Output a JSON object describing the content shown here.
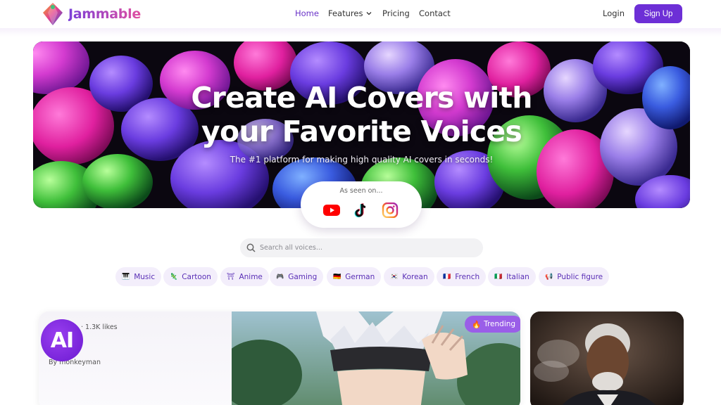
{
  "brand": {
    "name": "Jammable"
  },
  "nav": {
    "home": "Home",
    "features": "Features",
    "pricing": "Pricing",
    "contact": "Contact",
    "login": "Login",
    "signup": "Sign Up"
  },
  "hero": {
    "title_line1": "Create AI Covers with",
    "title_line2": "your Favorite Voices",
    "subtitle": "The #1 platform for making high quality AI covers in seconds!",
    "seen_on": "As seen on...",
    "platforms": [
      "youtube-icon",
      "tiktok-icon",
      "instagram-icon"
    ]
  },
  "search": {
    "placeholder": "Search all voices..."
  },
  "categories": [
    {
      "emoji": "🎹",
      "label": "Music"
    },
    {
      "emoji": "🦎",
      "label": "Cartoon"
    },
    {
      "emoji": "⛩",
      "label": "Anime"
    },
    {
      "emoji": "🎮",
      "label": "Gaming"
    },
    {
      "emoji": "🇩🇪",
      "label": "German"
    },
    {
      "emoji": "🇰🇷",
      "label": "Korean"
    },
    {
      "emoji": "🇫🇷",
      "label": "French"
    },
    {
      "emoji": "🇮🇹",
      "label": "Italian"
    },
    {
      "emoji": "📢",
      "label": "Public figure"
    }
  ],
  "featured": {
    "avatar_text": "AI",
    "likes": "· 1.3K likes",
    "author": "By monkeyman",
    "badge_emoji": "🔥",
    "badge": "Trending"
  },
  "colors": {
    "accent": "#6d2fd6",
    "chip_bg": "#f3eefb",
    "chip_text": "#5a2fb6",
    "trending_bg": "#9a5ee8"
  }
}
